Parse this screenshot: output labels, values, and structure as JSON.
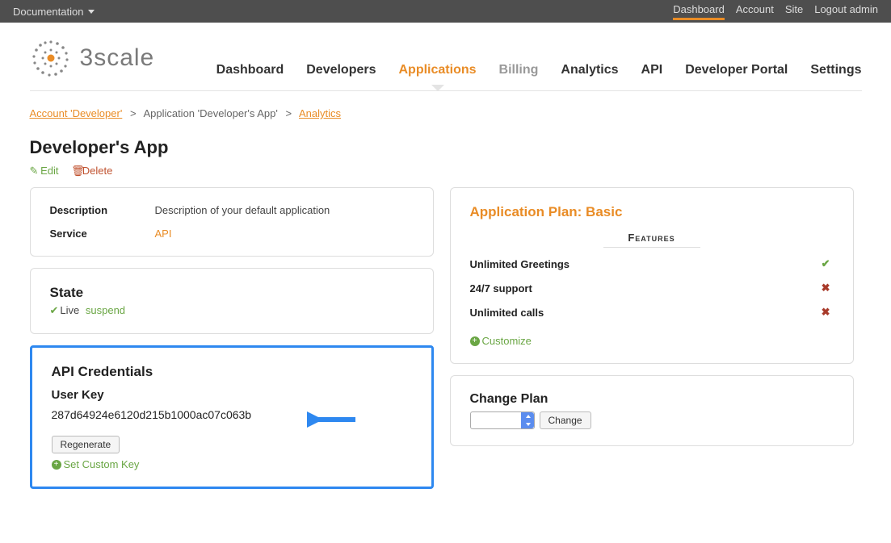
{
  "topbar": {
    "docs_label": "Documentation",
    "right": [
      {
        "label": "Dashboard",
        "active": true
      },
      {
        "label": "Account",
        "active": false
      },
      {
        "label": "Site",
        "active": false
      },
      {
        "label": "Logout admin",
        "active": false
      }
    ]
  },
  "brand": {
    "name": "3scale",
    "three": "3",
    "rest": "scale"
  },
  "main_nav": [
    {
      "label": "Dashboard",
      "state": ""
    },
    {
      "label": "Developers",
      "state": ""
    },
    {
      "label": "Applications",
      "state": "active"
    },
    {
      "label": "Billing",
      "state": "muted"
    },
    {
      "label": "Analytics",
      "state": ""
    },
    {
      "label": "API",
      "state": ""
    },
    {
      "label": "Developer Portal",
      "state": ""
    },
    {
      "label": "Settings",
      "state": ""
    }
  ],
  "breadcrumbs": {
    "account": "Account 'Developer'",
    "app": "Application 'Developer's App'",
    "analytics": "Analytics",
    "sep": ">"
  },
  "page_title": "Developer's App",
  "actions": {
    "edit": "Edit",
    "delete": "Delete"
  },
  "info": {
    "description_label": "Description",
    "description_value": "Description of your default application",
    "service_label": "Service",
    "service_value": "API"
  },
  "state": {
    "heading": "State",
    "status": "Live",
    "suspend": "suspend"
  },
  "credentials": {
    "heading": "API Credentials",
    "subheading": "User Key",
    "key": "287d64924e6120d215b1000ac07c063b",
    "regenerate": "Regenerate",
    "set_custom": "Set Custom Key"
  },
  "plan": {
    "title": "Application Plan: Basic",
    "features_heading": "Features",
    "features": [
      {
        "label": "Unlimited Greetings",
        "ok": true
      },
      {
        "label": "24/7 support",
        "ok": false
      },
      {
        "label": "Unlimited calls",
        "ok": false
      }
    ],
    "customize": "Customize"
  },
  "change_plan": {
    "heading": "Change Plan",
    "button": "Change"
  }
}
